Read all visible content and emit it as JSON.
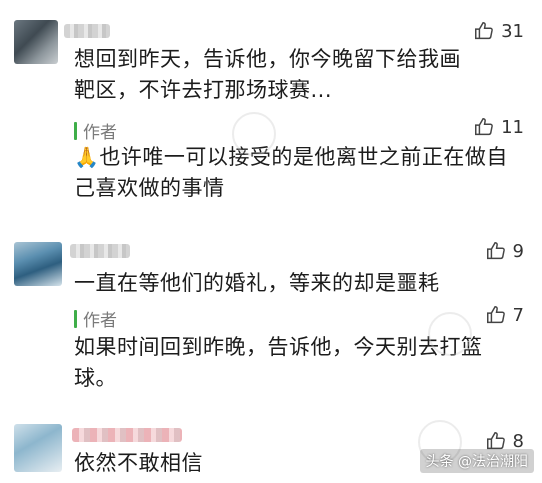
{
  "comments": [
    {
      "text": "想回到昨天，告诉他，你今晚留下给我画靶区，不许去打那场球赛...",
      "likes": "31",
      "author_label": "作者",
      "reply_emoji": "🙏",
      "reply_text": "也许唯一可以接受的是他离世之前正在做自己喜欢做的事情",
      "reply_likes": "11"
    },
    {
      "text": "一直在等他们的婚礼，等来的却是噩耗",
      "likes": "9",
      "author_label": "作者",
      "reply_text": "如果时间回到昨晚，告诉他，今天别去打篮球。",
      "reply_likes": "7"
    },
    {
      "text": "依然不敢相信",
      "likes": "8"
    }
  ],
  "watermark": "头条 @法治潮阳",
  "icons": {
    "like": "thumbs-up-icon",
    "author_marker": "green-bar"
  }
}
